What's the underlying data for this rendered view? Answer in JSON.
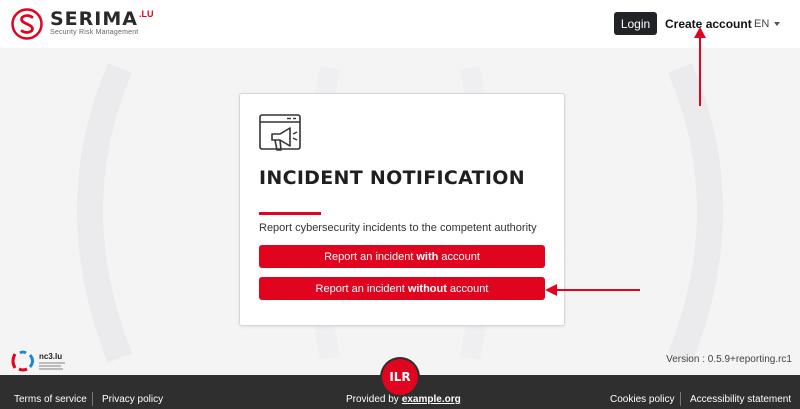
{
  "header": {
    "brand_name": "SERIMA",
    "brand_sup": ".LU",
    "brand_tagline": "Security Risk Management",
    "login_label": "Login",
    "create_account_label": "Create account",
    "language": "EN"
  },
  "card": {
    "title": "INCIDENT NOTIFICATION",
    "description": "Report cybersecurity incidents to the competent authority",
    "btn_with": {
      "pre": "Report an incident",
      "bold": "with",
      "post": "account"
    },
    "btn_without": {
      "pre": "Report an incident",
      "bold": "without",
      "post": "account"
    }
  },
  "partner": {
    "name": "nc3.lu"
  },
  "version": "Version : 0.5.9+reporting.rc1",
  "footer": {
    "terms": "Terms of service",
    "privacy": "Privacy policy",
    "provided_by": "Provided by",
    "provider": "example.org",
    "cookies": "Cookies policy",
    "accessibility": "Accessibility statement",
    "badge": "ILR"
  },
  "colors": {
    "accent": "#e0041f",
    "dark": "#222326",
    "footer": "#2f2f30"
  }
}
